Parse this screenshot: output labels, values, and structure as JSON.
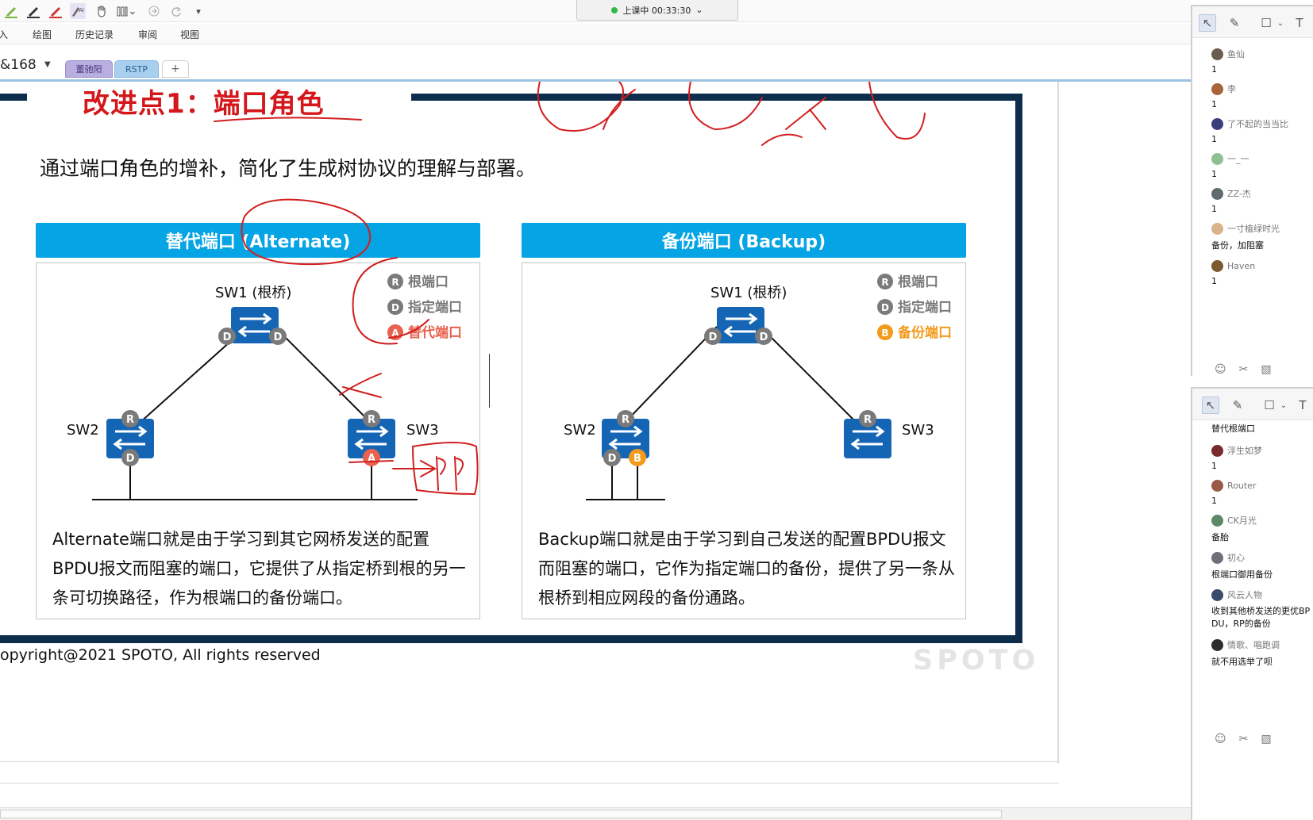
{
  "toolbar": {
    "session_status": "上课中 00:33:30",
    "caret": "⌄",
    "dropdown": "▾"
  },
  "menu": {
    "items": [
      "插入",
      "绘图",
      "历史记录",
      "审阅",
      "视图"
    ]
  },
  "tabs": {
    "page_number": "&168",
    "caret": "▼",
    "items": [
      "董驰阳",
      "RSTP"
    ],
    "add_label": "+"
  },
  "slide": {
    "title": "改进点1：端口角色",
    "subtitle": "通过端口角色的增补，简化了生成树协议的理解与部署。",
    "copyright": "opyright@2021 SPOTO, All rights reserved",
    "watermark": "SPOTO",
    "left": {
      "header": "替代端口 (Alternate)",
      "root_switch": "SW1 (根桥)",
      "sw2": "SW2",
      "sw3": "SW3",
      "legend": [
        {
          "icon": "R",
          "label": "根端口",
          "color": "#7a7a7a"
        },
        {
          "icon": "D",
          "label": "指定端口",
          "color": "#7a7a7a"
        },
        {
          "icon": "A",
          "label": "替代端口",
          "color": "#e8624e"
        }
      ],
      "ports": {
        "d": "D",
        "r": "R",
        "a": "A"
      },
      "annotation": "RP",
      "description": "Alternate端口就是由于学习到其它网桥发送的配置BPDU报文而阻塞的端口，它提供了从指定桥到根的另一条可切换路径，作为根端口的备份端口。"
    },
    "right": {
      "header": "备份端口 (Backup)",
      "root_switch": "SW1 (根桥)",
      "sw2": "SW2",
      "sw3": "SW3",
      "legend": [
        {
          "icon": "R",
          "label": "根端口",
          "color": "#7a7a7a"
        },
        {
          "icon": "D",
          "label": "指定端口",
          "color": "#7a7a7a"
        },
        {
          "icon": "B",
          "label": "备份端口",
          "color": "#f29a1a"
        }
      ],
      "ports": {
        "d": "D",
        "r": "R",
        "b": "B"
      },
      "description": "Backup端口就是由于学习到自己发送的配置BPDU报文而阻塞的端口，它作为指定端口的备份，提供了另一条从根桥到相应网段的备份通路。"
    }
  },
  "chat_top": {
    "messages": [
      {
        "name": "鱼仙",
        "text": "1",
        "color": "#6a5d4d"
      },
      {
        "name": "李",
        "text": "1",
        "color": "#a8643a"
      },
      {
        "name": "了不起的当当比",
        "text": "1",
        "color": "#3a3f7a"
      },
      {
        "name": "一_一",
        "text": "1",
        "color": "#8fbf94"
      },
      {
        "name": "ZZ-杰",
        "text": "1",
        "color": "#5f6b6f"
      },
      {
        "name": "一寸植绿时光",
        "text": "备份，加阻塞",
        "color": "#d9b38a"
      },
      {
        "name": "Haven",
        "text": "1",
        "color": "#7a5a30"
      }
    ]
  },
  "chat_bottom": {
    "heading": "替代根端口",
    "messages": [
      {
        "name": "浮生如梦",
        "text": "1",
        "color": "#7a2b2b"
      },
      {
        "name": "Router",
        "text": "1",
        "color": "#9a5a4a"
      },
      {
        "name": "CK月光",
        "text": "备胎",
        "color": "#5a8a6a"
      },
      {
        "name": "初心",
        "text": "根端口御用备份",
        "color": "#6f6f7a"
      },
      {
        "name": "风云人物",
        "text": "收到其他桥发送的更优BPDU，RP的备份",
        "color": "#3a4a6a"
      },
      {
        "name": "情歌、唱跑调",
        "text": "就不用选举了呗",
        "color": "#2e2e2e"
      }
    ]
  },
  "chat_icons": {
    "emoji": "☺",
    "scissors": "✂",
    "image": "▧",
    "pointer": "↖",
    "pen": "✎",
    "shape": "☐",
    "text": "T",
    "shape_caret": "⌄"
  }
}
